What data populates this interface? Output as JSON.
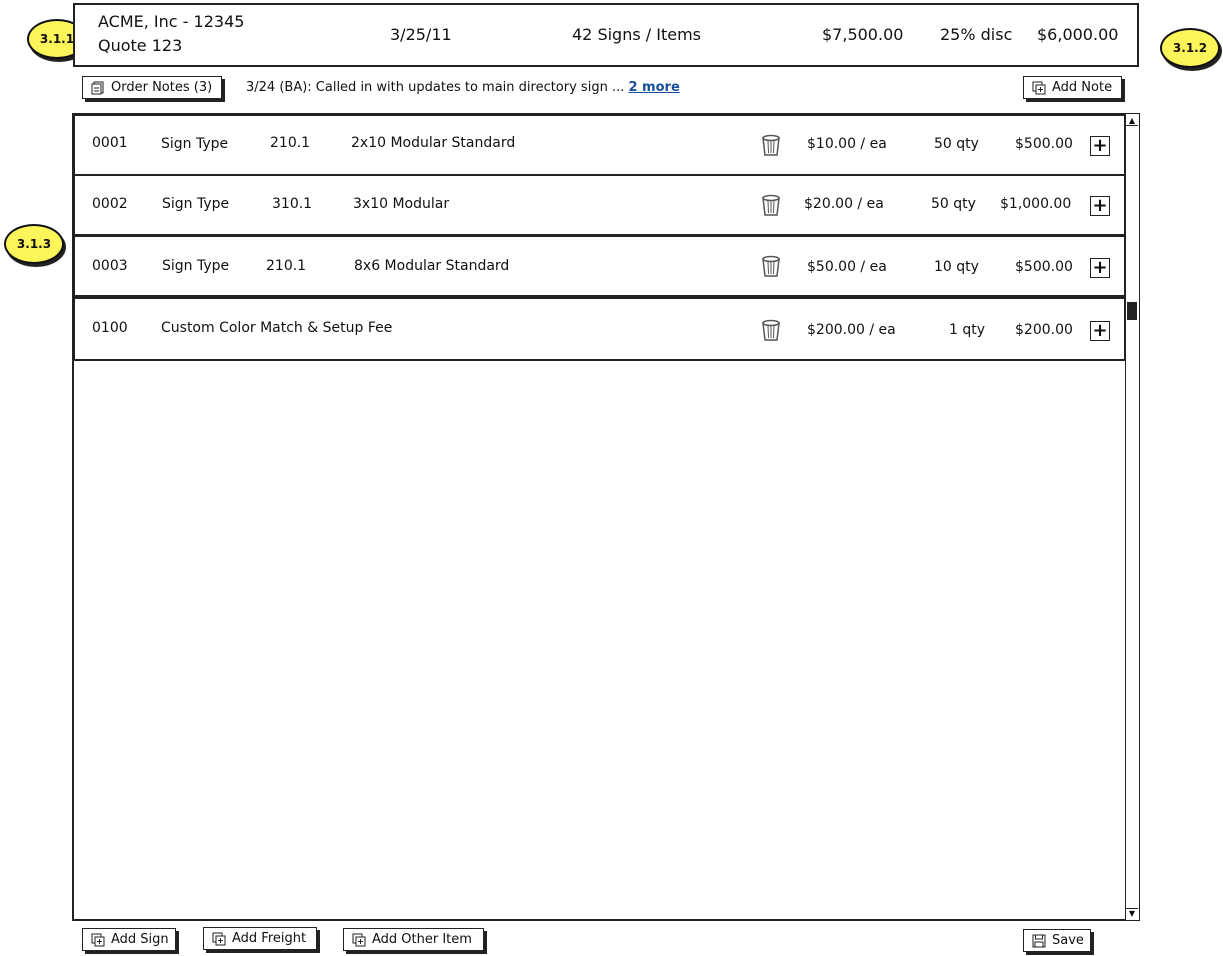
{
  "header": {
    "customer": "ACME, Inc - 12345",
    "quote": "Quote 123",
    "date": "3/25/11",
    "items_count": "42 Signs / Items",
    "subtotal": "$7,500.00",
    "discount": "25% disc",
    "total": "$6,000.00"
  },
  "callouts": {
    "header_left": "3.1.1",
    "header_right": "3.1.2",
    "rows": "3.1.3"
  },
  "notes": {
    "button_label": "Order Notes (3)",
    "latest": "3/24 (BA): Called in with updates to main directory sign ...",
    "more_link": "2 more",
    "add_note_label": "Add Note"
  },
  "rows": [
    {
      "id": "0001",
      "kind": "Sign Type",
      "type_code": "210.1",
      "description": "2x10 Modular Standard",
      "price": "$10.00 / ea",
      "qty": "50 qty",
      "total": "$500.00"
    },
    {
      "id": "0002",
      "kind": "Sign Type",
      "type_code": "310.1",
      "description": "3x10 Modular",
      "price": "$20.00 / ea",
      "qty": "50 qty",
      "total": "$1,000.00"
    },
    {
      "id": "0003",
      "kind": "Sign Type",
      "type_code": "210.1",
      "description": "8x6 Modular Standard",
      "price": "$50.00 / ea",
      "qty": "10 qty",
      "total": "$500.00"
    },
    {
      "id": "0100",
      "description": "Custom Color Match & Setup Fee",
      "price": "$200.00 / ea",
      "qty": "1 qty",
      "total": "$200.00"
    }
  ],
  "footer": {
    "add_sign": "Add Sign",
    "add_freight": "Add Freight",
    "add_other": "Add Other Item",
    "save": "Save"
  },
  "colors": {
    "callout": "#fdf65a",
    "link": "#1a4f9c",
    "border": "#222222"
  }
}
